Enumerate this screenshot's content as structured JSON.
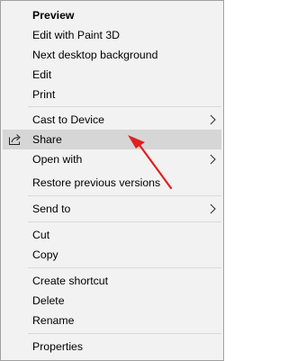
{
  "menu": {
    "items": [
      {
        "label": "Preview"
      },
      {
        "label": "Edit with Paint 3D"
      },
      {
        "label": "Next desktop background"
      },
      {
        "label": "Edit"
      },
      {
        "label": "Print"
      },
      {
        "label": "Cast to Device"
      },
      {
        "label": "Share",
        "icon": "share-icon"
      },
      {
        "label": "Open with"
      },
      {
        "label": "Restore previous versions"
      },
      {
        "label": "Send to"
      },
      {
        "label": "Cut"
      },
      {
        "label": "Copy"
      },
      {
        "label": "Create shortcut"
      },
      {
        "label": "Delete"
      },
      {
        "label": "Rename"
      },
      {
        "label": "Properties"
      }
    ],
    "highlighted_item": "Share",
    "submenu_arrow_icon": "chevron-right-icon"
  },
  "annotation": {
    "arrow_color": "#e02020"
  }
}
